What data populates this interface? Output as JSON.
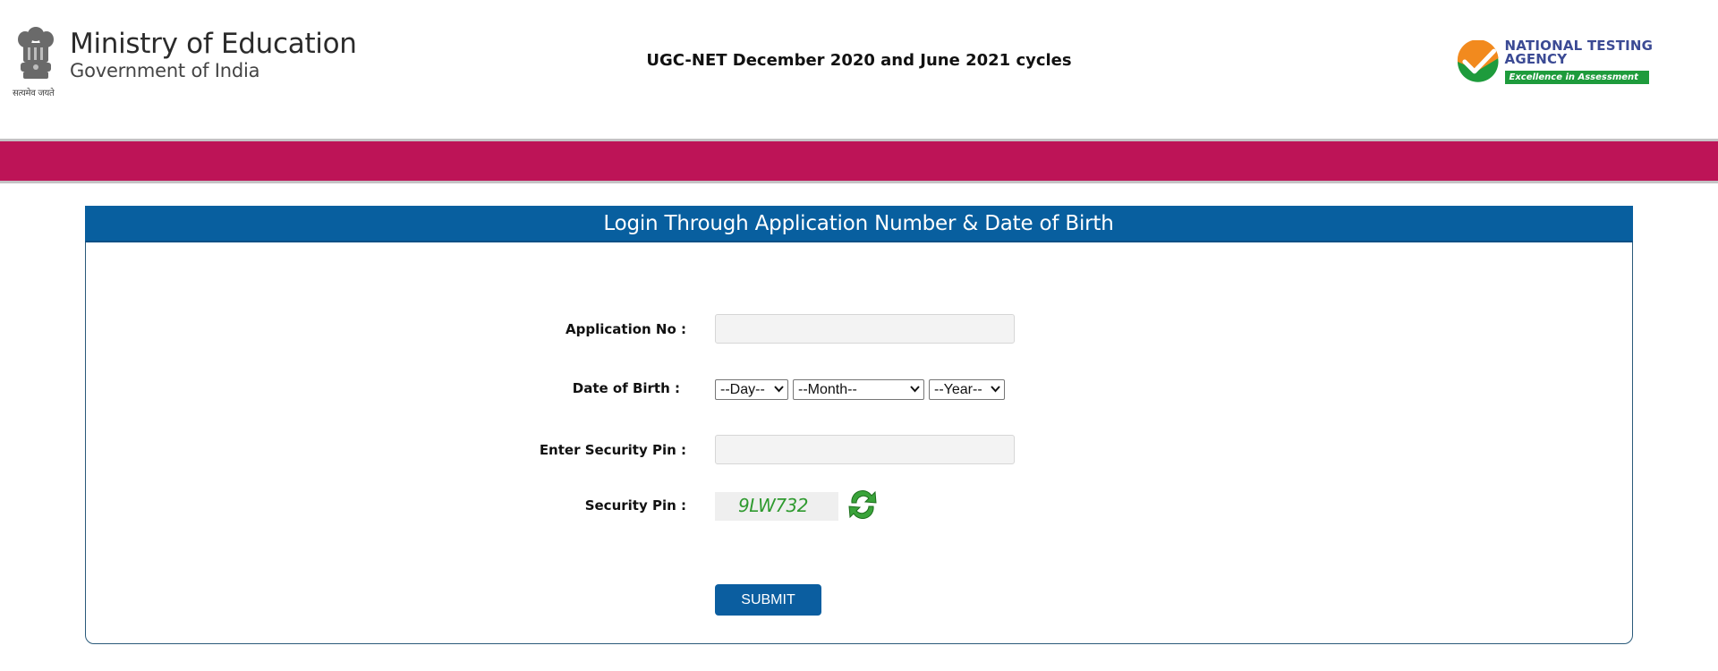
{
  "header": {
    "ministry_title": "Ministry of Education",
    "ministry_subtitle": "Government of India",
    "emblem_caption": "सत्यमेव जयते",
    "page_title": "UGC-NET December 2020 and June 2021 cycles",
    "agency_title": "NATIONAL TESTING AGENCY",
    "agency_tagline": "Excellence in Assessment"
  },
  "colors": {
    "band": "#bd1457",
    "primary": "#085f9f",
    "captcha_text": "#2f9a2f",
    "agency_blue": "#3b4a94",
    "agency_green": "#1e9b3c"
  },
  "login": {
    "heading": "Login Through Application Number & Date of Birth",
    "fields": {
      "application_no": {
        "label": "Application No :",
        "value": "",
        "placeholder": ""
      },
      "dob": {
        "label": "Date of Birth :",
        "day": "--Day--",
        "month": "--Month--",
        "year": "--Year--"
      },
      "security_pin_input": {
        "label": "Enter Security Pin :",
        "value": "",
        "placeholder": ""
      },
      "security_pin": {
        "label": "Security Pin :",
        "captcha": "9LW732",
        "refresh_icon": "refresh-icon"
      }
    },
    "submit_label": "SUBMIT"
  }
}
